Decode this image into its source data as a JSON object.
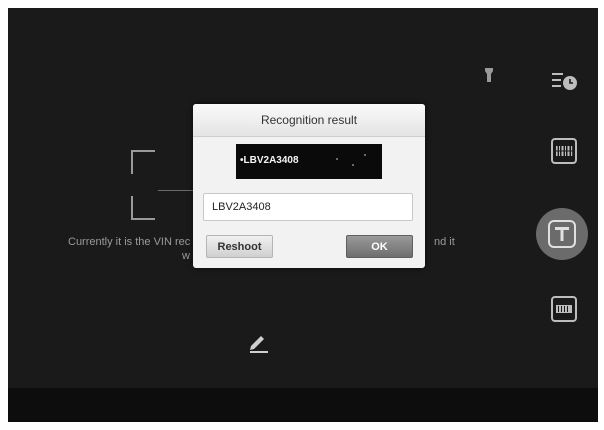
{
  "dialog": {
    "title": "Recognition result",
    "plate_text": "•LBV2A3408",
    "result_value": "LBV2A3408",
    "reshoot_label": "Reshoot",
    "ok_label": "OK"
  },
  "hint": {
    "part_a": "Currently it is the VIN rec",
    "part_b": "nd it",
    "part_c": "w"
  },
  "toolbar": {
    "icons": [
      "flashlight-icon",
      "history-icon",
      "barcode-scan-icon",
      "text-recognition-icon",
      "vin-scan-icon"
    ]
  },
  "colors": {
    "background": "#1a1a1a",
    "dialog": "#f2f2f2",
    "ok_button": "#7a7a7a"
  }
}
